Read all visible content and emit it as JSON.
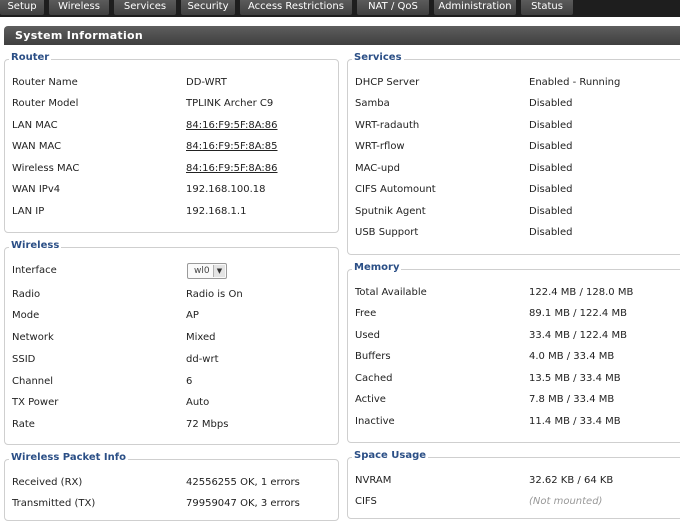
{
  "nav": {
    "tabs": [
      "Setup",
      "Wireless",
      "Services",
      "Security",
      "Access Restrictions",
      "NAT / QoS",
      "Administration",
      "Status"
    ]
  },
  "section": {
    "title": "System Information"
  },
  "router": {
    "legend": "Router",
    "rows": [
      {
        "label": "Router Name",
        "value": "DD-WRT"
      },
      {
        "label": "Router Model",
        "value": "TPLINK Archer C9"
      },
      {
        "label": "LAN MAC",
        "value": "84:16:F9:5F:8A:86"
      },
      {
        "label": "WAN MAC",
        "value": "84:16:F9:5F:8A:85"
      },
      {
        "label": "Wireless MAC",
        "value": "84:16:F9:5F:8A:86"
      },
      {
        "label": "WAN IPv4",
        "value": "192.168.100.18"
      },
      {
        "label": "LAN IP",
        "value": "192.168.1.1"
      }
    ]
  },
  "wireless": {
    "legend": "Wireless",
    "interface": {
      "label": "Interface",
      "value": "wl0"
    },
    "rows": [
      {
        "label": "Radio",
        "value": "Radio is On"
      },
      {
        "label": "Mode",
        "value": "AP"
      },
      {
        "label": "Network",
        "value": "Mixed"
      },
      {
        "label": "SSID",
        "value": "dd-wrt"
      },
      {
        "label": "Channel",
        "value": "6"
      },
      {
        "label": "TX Power",
        "value": "Auto"
      },
      {
        "label": "Rate",
        "value": "72 Mbps"
      }
    ]
  },
  "packet": {
    "legend": "Wireless Packet Info",
    "rows": [
      {
        "label": "Received (RX)",
        "value": "42556255 OK, 1 errors"
      },
      {
        "label": "Transmitted (TX)",
        "value": "79959047 OK, 3 errors"
      }
    ]
  },
  "services": {
    "legend": "Services",
    "rows": [
      {
        "label": "DHCP Server",
        "value": "Enabled - Running"
      },
      {
        "label": "Samba",
        "value": "Disabled"
      },
      {
        "label": "WRT-radauth",
        "value": "Disabled"
      },
      {
        "label": "WRT-rflow",
        "value": "Disabled"
      },
      {
        "label": "MAC-upd",
        "value": "Disabled"
      },
      {
        "label": "CIFS Automount",
        "value": "Disabled"
      },
      {
        "label": "Sputnik Agent",
        "value": "Disabled"
      },
      {
        "label": "USB Support",
        "value": "Disabled"
      }
    ]
  },
  "memory": {
    "legend": "Memory",
    "rows": [
      {
        "label": "Total Available",
        "value": "122.4 MB / 128.0 MB"
      },
      {
        "label": "Free",
        "value": "89.1 MB / 122.4 MB"
      },
      {
        "label": "Used",
        "value": "33.4 MB / 122.4 MB"
      },
      {
        "label": "Buffers",
        "value": "4.0 MB / 33.4 MB"
      },
      {
        "label": "Cached",
        "value": "13.5 MB / 33.4 MB"
      },
      {
        "label": "Active",
        "value": "7.8 MB / 33.4 MB"
      },
      {
        "label": "Inactive",
        "value": "11.4 MB / 33.4 MB"
      }
    ]
  },
  "space": {
    "legend": "Space Usage",
    "rows": [
      {
        "label": "NVRAM",
        "value": "32.62 KB / 64 KB"
      },
      {
        "label": "CIFS",
        "value": "(Not mounted)"
      }
    ]
  }
}
